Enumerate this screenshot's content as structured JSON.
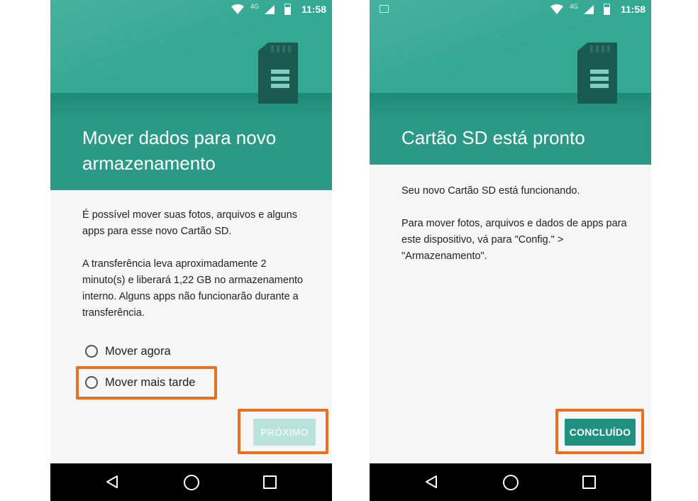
{
  "status_bar": {
    "time": "11:58",
    "network": "4G"
  },
  "left_screen": {
    "title": "Mover dados para novo armazenamento",
    "paragraph1": "É possível mover suas fotos, arquivos e alguns apps para esse novo Cartão SD.",
    "paragraph2": "A transferência leva aproximadamente 2 minuto(s) e liberará 1,22 GB no armazenamento interno. Alguns apps não funcionarão durante a transferência.",
    "options": [
      {
        "label": "Mover agora",
        "selected": false
      },
      {
        "label": "Mover mais tarde",
        "selected": false
      }
    ],
    "next_button": "PRÓXIMO"
  },
  "right_screen": {
    "title": "Cartão SD está pronto",
    "paragraph1": "Seu novo Cartão SD está funcionando.",
    "paragraph2": "Para mover fotos, arquivos e dados de apps para este dispositivo, vá para \"Config.\" > \"Armazenamento\".",
    "done_button": "CONCLUÍDO"
  },
  "colors": {
    "header_teal": "#2a9a86",
    "button_teal": "#1f917e",
    "button_disabled": "#b9e2db",
    "highlight_orange": "#e8711f"
  },
  "icons": {
    "header_illustration": "sd-card-icon",
    "nav": [
      "back-icon",
      "home-icon",
      "recents-icon"
    ]
  }
}
